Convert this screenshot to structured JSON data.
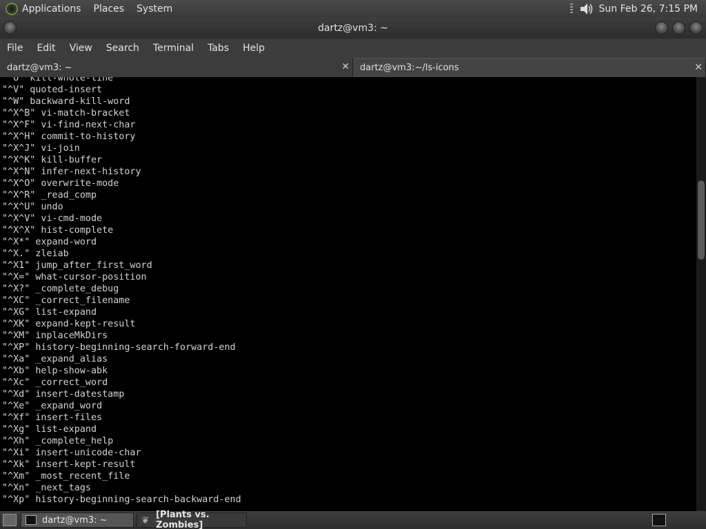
{
  "top_panel": {
    "menus": [
      "Applications",
      "Places",
      "System"
    ],
    "clock": "Sun Feb 26,  7:15 PM"
  },
  "window": {
    "title": "dartz@vm3: ~"
  },
  "menu_bar": [
    "File",
    "Edit",
    "View",
    "Search",
    "Terminal",
    "Tabs",
    "Help"
  ],
  "tabs": [
    {
      "label": "dartz@vm3: ~",
      "active": true
    },
    {
      "label": "dartz@vm3:~/ls-icons",
      "active": false
    }
  ],
  "terminal": {
    "lines": [
      "\"^U\" kill-whole-line",
      "\"^V\" quoted-insert",
      "\"^W\" backward-kill-word",
      "\"^X^B\" vi-match-bracket",
      "\"^X^F\" vi-find-next-char",
      "\"^X^H\" commit-to-history",
      "\"^X^J\" vi-join",
      "\"^X^K\" kill-buffer",
      "\"^X^N\" infer-next-history",
      "\"^X^O\" overwrite-mode",
      "\"^X^R\" _read_comp",
      "\"^X^U\" undo",
      "\"^X^V\" vi-cmd-mode",
      "\"^X^X\" hist-complete",
      "\"^X*\" expand-word",
      "\"^X.\" zleiab",
      "\"^X1\" jump_after_first_word",
      "\"^X=\" what-cursor-position",
      "\"^X?\" _complete_debug",
      "\"^XC\" _correct_filename",
      "\"^XG\" list-expand",
      "\"^XK\" expand-kept-result",
      "\"^XM\" inplaceMkDirs",
      "\"^XP\" history-beginning-search-forward-end",
      "\"^Xa\" _expand_alias",
      "\"^Xb\" help-show-abk",
      "\"^Xc\" _correct_word",
      "\"^Xd\" insert-datestamp",
      "\"^Xe\" _expand_word",
      "\"^Xf\" insert-files",
      "\"^Xg\" list-expand",
      "\"^Xh\" _complete_help",
      "\"^Xi\" insert-unicode-char",
      "\"^Xk\" insert-kept-result",
      "\"^Xm\" _most_recent_file",
      "\"^Xn\" _next_tags",
      "\"^Xp\" history-beginning-search-backward-end"
    ]
  },
  "taskbar": {
    "tasks": [
      {
        "label": "dartz@vm3: ~",
        "icon": "terminal-icon"
      },
      {
        "label": "[Plants vs. Zombies]",
        "icon": "leaf-icon"
      }
    ]
  }
}
